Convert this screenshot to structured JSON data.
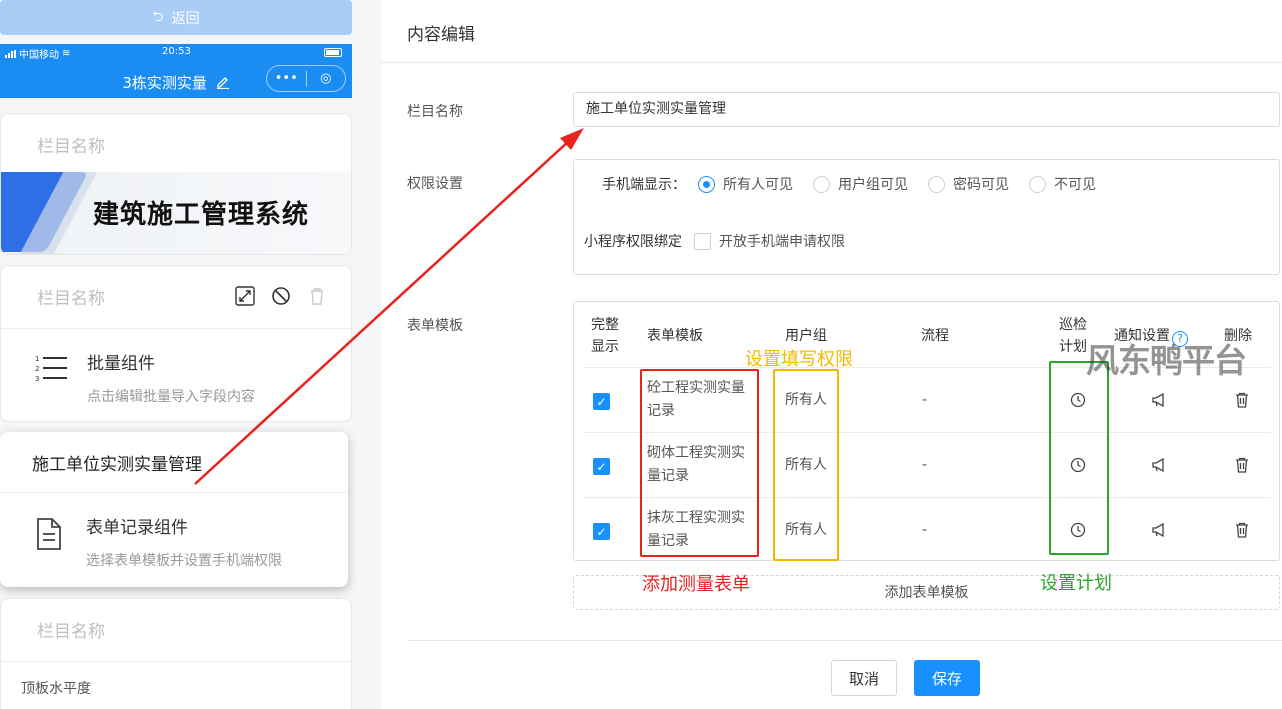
{
  "preview": {
    "back_label": "返回",
    "status_carrier": "中国移动",
    "status_time": "20:53",
    "page_title": "3栋实测实量",
    "capsule_more": "•••",
    "capsule_target": "◎",
    "card1": {
      "title": "栏目名称",
      "banner_text": "建筑施工管理系统"
    },
    "card2": {
      "title": "栏目名称",
      "component_name": "批量组件",
      "component_desc": "点击编辑批量导入字段内容"
    },
    "card3": {
      "title": "施工单位实测实量管理",
      "component_name": "表单记录组件",
      "component_desc": "选择表单模板并设置手机端权限"
    },
    "card4": {
      "title": "栏目名称",
      "item": "顶板水平度"
    }
  },
  "editor": {
    "title": "内容编辑",
    "column_name_label": "栏目名称",
    "column_name_value": "施工单位实测实量管理",
    "permission_label": "权限设置",
    "mobile_display_label": "手机端显示：",
    "mobile_options": [
      "所有人可见",
      "用户组可见",
      "密码可见",
      "不可见"
    ],
    "mobile_selected_index": 0,
    "miniapp_binding_label": "小程序权限绑定",
    "miniapp_binding_option": "开放手机端申请权限",
    "template_label": "表单模板",
    "table": {
      "headers": {
        "full_display_1": "完整",
        "full_display_2": "显示",
        "template": "表单模板",
        "user_group": "用户组",
        "flow": "流程",
        "inspection_1": "巡检",
        "inspection_2": "计划",
        "notify": "通知设置",
        "delete": "删除",
        "help": "?"
      },
      "rows": [
        {
          "template_line1": "砼工程实测实量",
          "template_line2": "记录",
          "user_group": "所有人",
          "flow": "-"
        },
        {
          "template_line1": "砌体工程实测实",
          "template_line2": "量记录",
          "user_group": "所有人",
          "flow": "-"
        },
        {
          "template_line1": "抹灰工程实测实",
          "template_line2": "量记录",
          "user_group": "所有人",
          "flow": "-"
        }
      ]
    },
    "add_template_label": "添加表单模板",
    "cancel_label": "取消",
    "save_label": "保存"
  },
  "annotations": {
    "red_label": "添加测量表单",
    "yellow_label": "设置填写权限",
    "green_label": "设置计划",
    "watermark": "风东鸭平台",
    "colors": {
      "red": "#e8231f",
      "yellow": "#f5b800",
      "green": "#2aa52a",
      "primary": "#1890ff"
    }
  }
}
